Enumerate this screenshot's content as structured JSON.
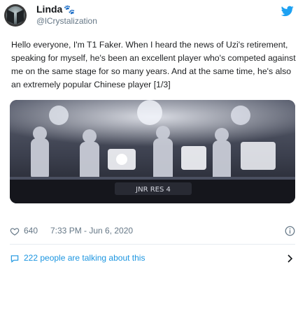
{
  "author": {
    "name": "Linda",
    "name_emoji": "🐾",
    "handle": "@lCrystalization"
  },
  "tweet": {
    "text": "Hello everyone, I'm T1 Faker. When I heard the news of Uzi's retirement, speaking for myself, he's been an excellent player who's competed against me on the same stage for so many years. And at the same time, he's also an extremely popular Chinese player [1/3]"
  },
  "media": {
    "icon": "photo-of-players-on-stage",
    "caption_overlay": "JNR RES 4"
  },
  "meta": {
    "likes": "640",
    "timestamp": "7:33 PM - Jun 6, 2020"
  },
  "conversation": {
    "label": "222 people are talking about this"
  },
  "colors": {
    "accent": "#1b95e0",
    "muted": "#657786",
    "text": "#14171a"
  }
}
